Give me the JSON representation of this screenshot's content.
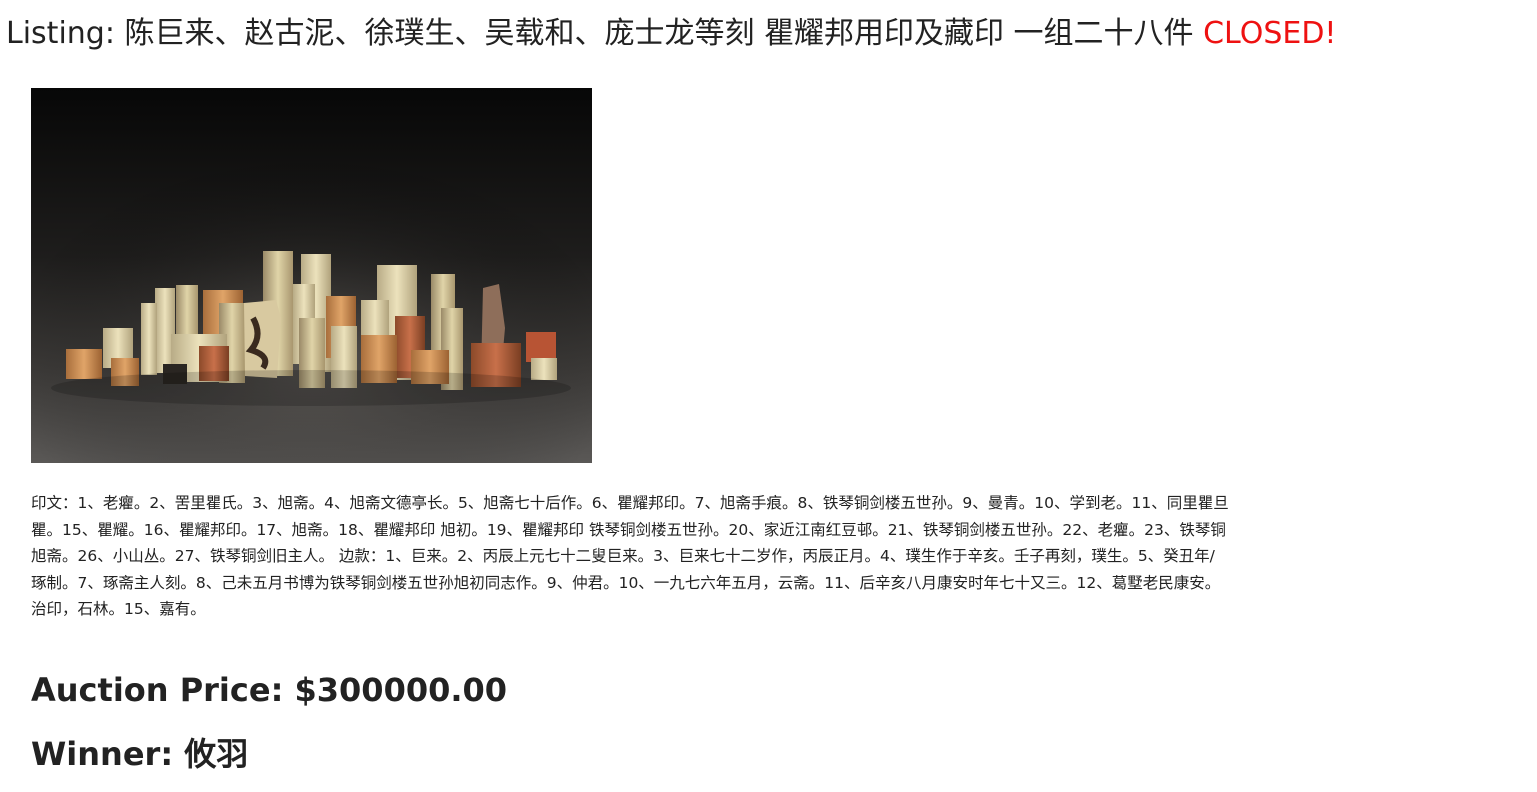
{
  "listing": {
    "prefix": "Listing: ",
    "title": "陈巨来、赵古泥、徐璞生、吴载和、庞士龙等刻 瞿耀邦用印及藏印 一组二十八件",
    "status": "CLOSED!"
  },
  "image": {
    "alt": "photo-of-seals"
  },
  "description": {
    "lines": [
      "印文：1、老癯。2、罟里瞿氏。3、旭斋。4、旭斋文德亭长。5、旭斋七十后作。6、瞿耀邦印。7、旭斋手痕。8、铁琴铜剑楼五世孙。9、曼青。10、学到老。11、同里瞿旦",
      "瞿。15、瞿耀。16、瞿耀邦印。17、旭斋。18、瞿耀邦印 旭初。19、瞿耀邦印 铁琴铜剑楼五世孙。20、家近江南红豆邨。21、铁琴铜剑楼五世孙。22、老癯。23、铁琴铜",
      "旭斋。26、小山丛。27、铁琴铜剑旧主人。 边款：1、巨来。2、丙辰上元七十二叟巨来。3、巨来七十二岁作，丙辰正月。4、璞生作于辛亥。壬子再刻，璞生。5、癸丑年/",
      "琢制。7、琢斋主人刻。8、己未五月书博为铁琴铜剑楼五世孙旭初同志作。9、仲君。10、一九七六年五月，云斋。11、后辛亥八月康安时年七十又三。12、葛墅老民康安。",
      "治印，石林。15、嘉有。"
    ]
  },
  "price": {
    "label": "Auction Price: ",
    "value": "$300000.00"
  },
  "winner": {
    "label": "Winner: ",
    "value": "攸羽"
  },
  "colors": {
    "closed": "#ee1111",
    "text": "#222222"
  }
}
